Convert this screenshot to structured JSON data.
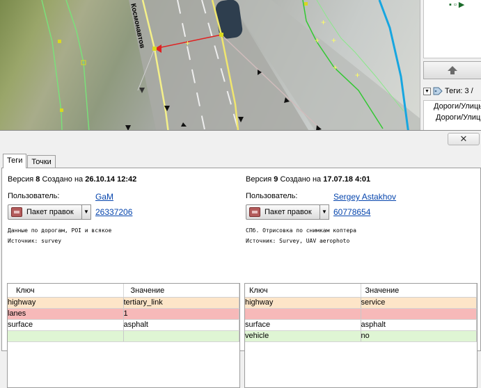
{
  "map": {
    "street_label": "Космонавтов"
  },
  "side_panel": {
    "tags_title": "Теги: 3 /",
    "tag_items": [
      "Дороги/Улицы",
      "Дороги/Улиц"
    ]
  },
  "dialog": {
    "close_label": "✕",
    "tabs": [
      {
        "label": "Теги",
        "active": true
      },
      {
        "label": "Точки",
        "active": false
      }
    ],
    "left": {
      "version_prefix": "Версия",
      "version_number": "8",
      "created_text": "Создано на",
      "created_date": "26.10.14 12:42",
      "user_label": "Пользователь:",
      "user_name": "GaM",
      "changeset_button": "Пакет правок",
      "changeset_id": "26337206",
      "comment": "Данные по дорогам, POI и всякое",
      "source": "Источник: survey",
      "table": {
        "key_header": "Ключ",
        "value_header": "Значение",
        "rows": [
          {
            "key": "highway",
            "value": "tertiary_link",
            "status": "changed"
          },
          {
            "key": "lanes",
            "value": "1",
            "status": "removed"
          },
          {
            "key": "surface",
            "value": "asphalt",
            "status": "same"
          },
          {
            "key": "",
            "value": "",
            "status": "added"
          }
        ]
      }
    },
    "right": {
      "version_prefix": "Версия",
      "version_number": "9",
      "created_text": "Создано на",
      "created_date": "17.07.18 4:01",
      "user_label": "Пользователь:",
      "user_name": "Sergey Astakhov",
      "changeset_button": "Пакет правок",
      "changeset_id": "60778654",
      "comment": "СПб. Отрисовка по снимкам коптера",
      "source": "Источник: Survey, UAV aerophoto",
      "table": {
        "key_header": "Ключ",
        "value_header": "Значение",
        "rows": [
          {
            "key": "highway",
            "value": "service",
            "status": "changed"
          },
          {
            "key": "",
            "value": "",
            "status": "removed"
          },
          {
            "key": "surface",
            "value": "asphalt",
            "status": "same"
          },
          {
            "key": "vehicle",
            "value": "no",
            "status": "added"
          }
        ]
      }
    }
  },
  "colors": {
    "changed": "#fde5c8",
    "removed": "#f7b9b9",
    "added": "#dff5d4",
    "link": "#0645ad"
  }
}
